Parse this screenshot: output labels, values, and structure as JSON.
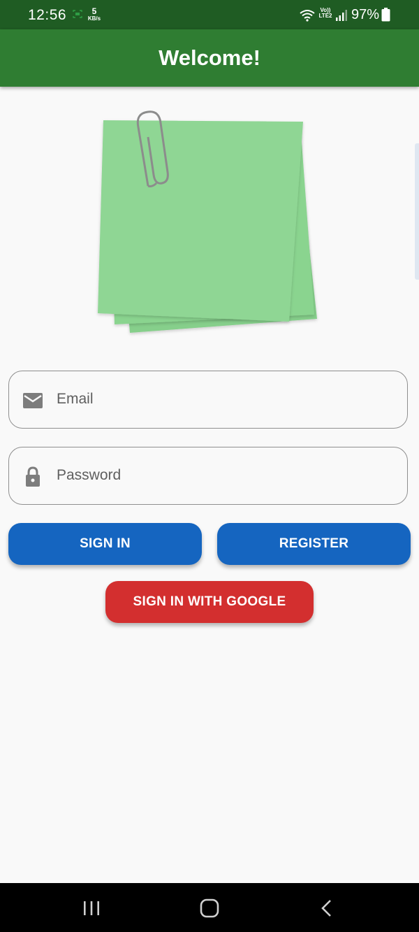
{
  "status_bar": {
    "time": "12:56",
    "net_speed_value": "5",
    "net_speed_unit": "KB/s",
    "volte_top": "Vo))",
    "volte_bottom": "LTE2",
    "battery_percent": "97%",
    "icons": [
      "screen-record-icon",
      "wifi-icon",
      "signal-icon",
      "battery-icon"
    ]
  },
  "app_bar": {
    "title": "Welcome!",
    "color": "#2f7d32"
  },
  "hero_image": {
    "description_icon": "sticky-notes-with-paperclip",
    "note_color": "#8fd694"
  },
  "form": {
    "email": {
      "placeholder": "Email",
      "value": "",
      "icon": "mail-icon"
    },
    "password": {
      "placeholder": "Password",
      "value": "",
      "icon": "lock-icon"
    }
  },
  "buttons": {
    "sign_in": "SIGN IN",
    "register": "REGISTER",
    "sign_in_google": "SIGN IN WITH GOOGLE",
    "primary_color": "#1565c0",
    "google_color": "#d32f2f"
  },
  "nav_bar": {
    "icons": [
      "recent-apps-icon",
      "home-icon",
      "back-icon"
    ]
  }
}
